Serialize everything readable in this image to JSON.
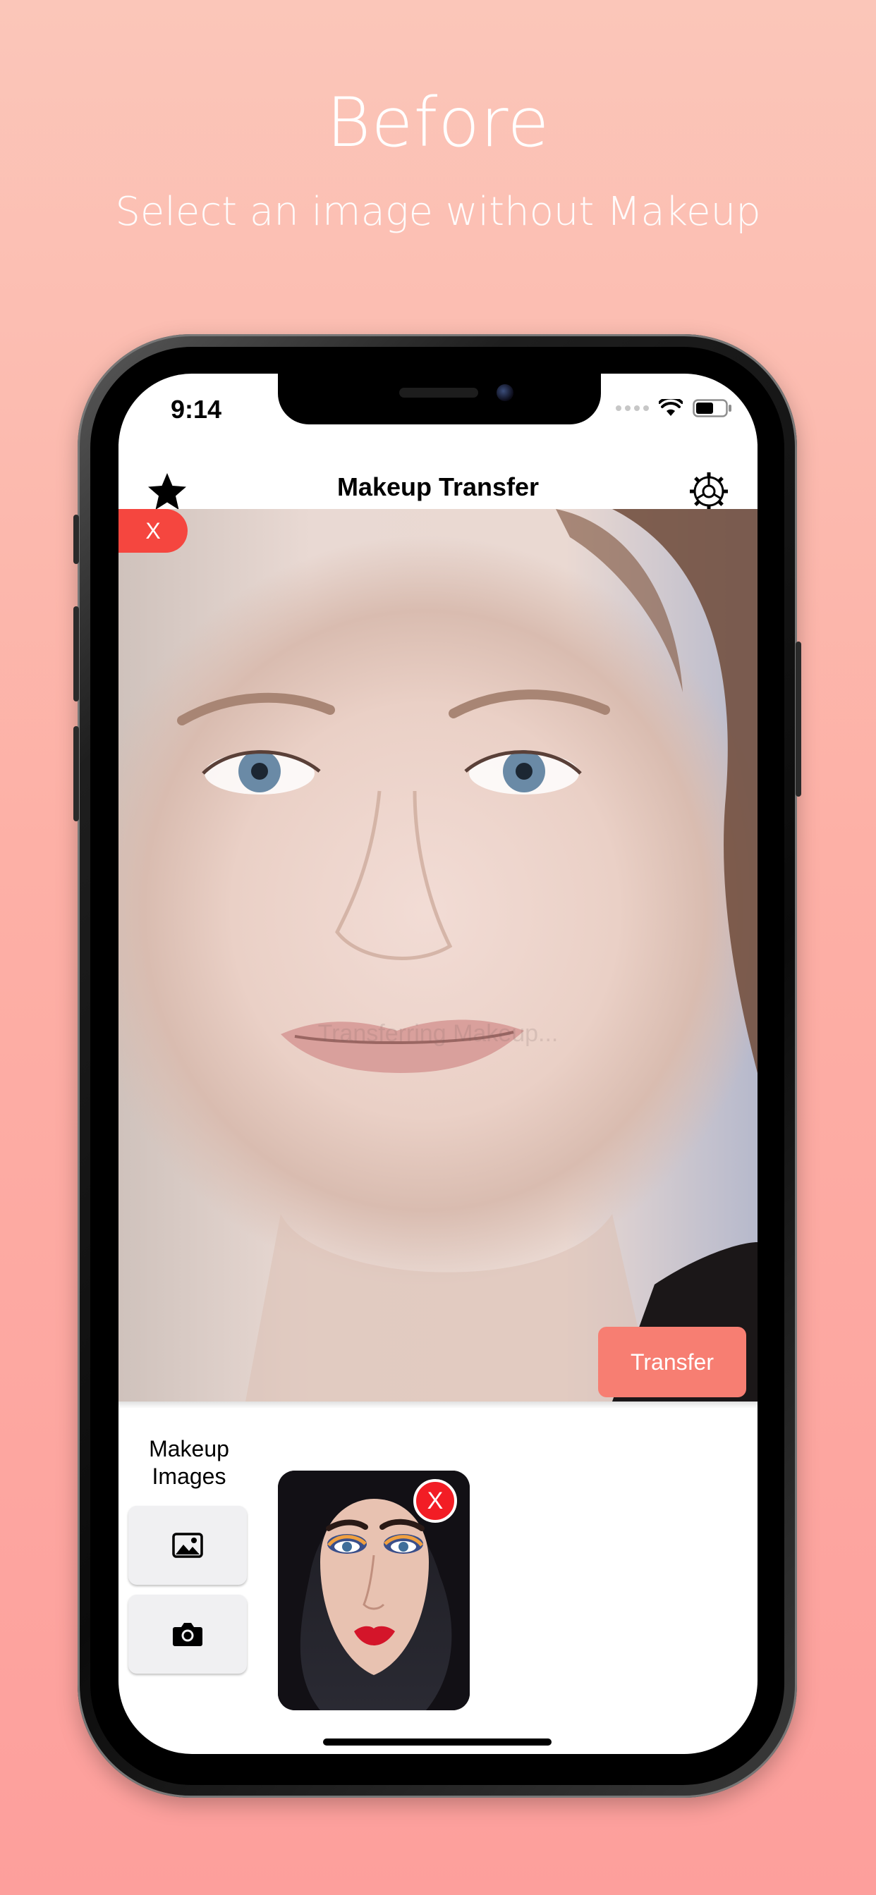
{
  "hero": {
    "title": "Before",
    "subtitle": "Select an image without Makeup"
  },
  "status_bar": {
    "time": "9:14",
    "icons": [
      "signal-icon",
      "wifi-icon",
      "battery-icon"
    ]
  },
  "navbar": {
    "title": "Makeup Transfer",
    "left_icon": "star-icon",
    "right_icon": "gear-icon"
  },
  "photo": {
    "clear_label": "X",
    "overlay_text": "Transferring Makeup...",
    "transfer_label": "Transfer"
  },
  "panel": {
    "makeup_label": "Makeup Images",
    "gallery_icon": "photo-library-icon",
    "camera_icon": "camera-icon",
    "thumb_remove_label": "X"
  },
  "colors": {
    "background_top": "#fbc6b9",
    "background_bottom": "#fd9f9c",
    "clear_button": "#f5463f",
    "transfer_button": "#f77e72",
    "thumb_remove": "#f21d25"
  }
}
